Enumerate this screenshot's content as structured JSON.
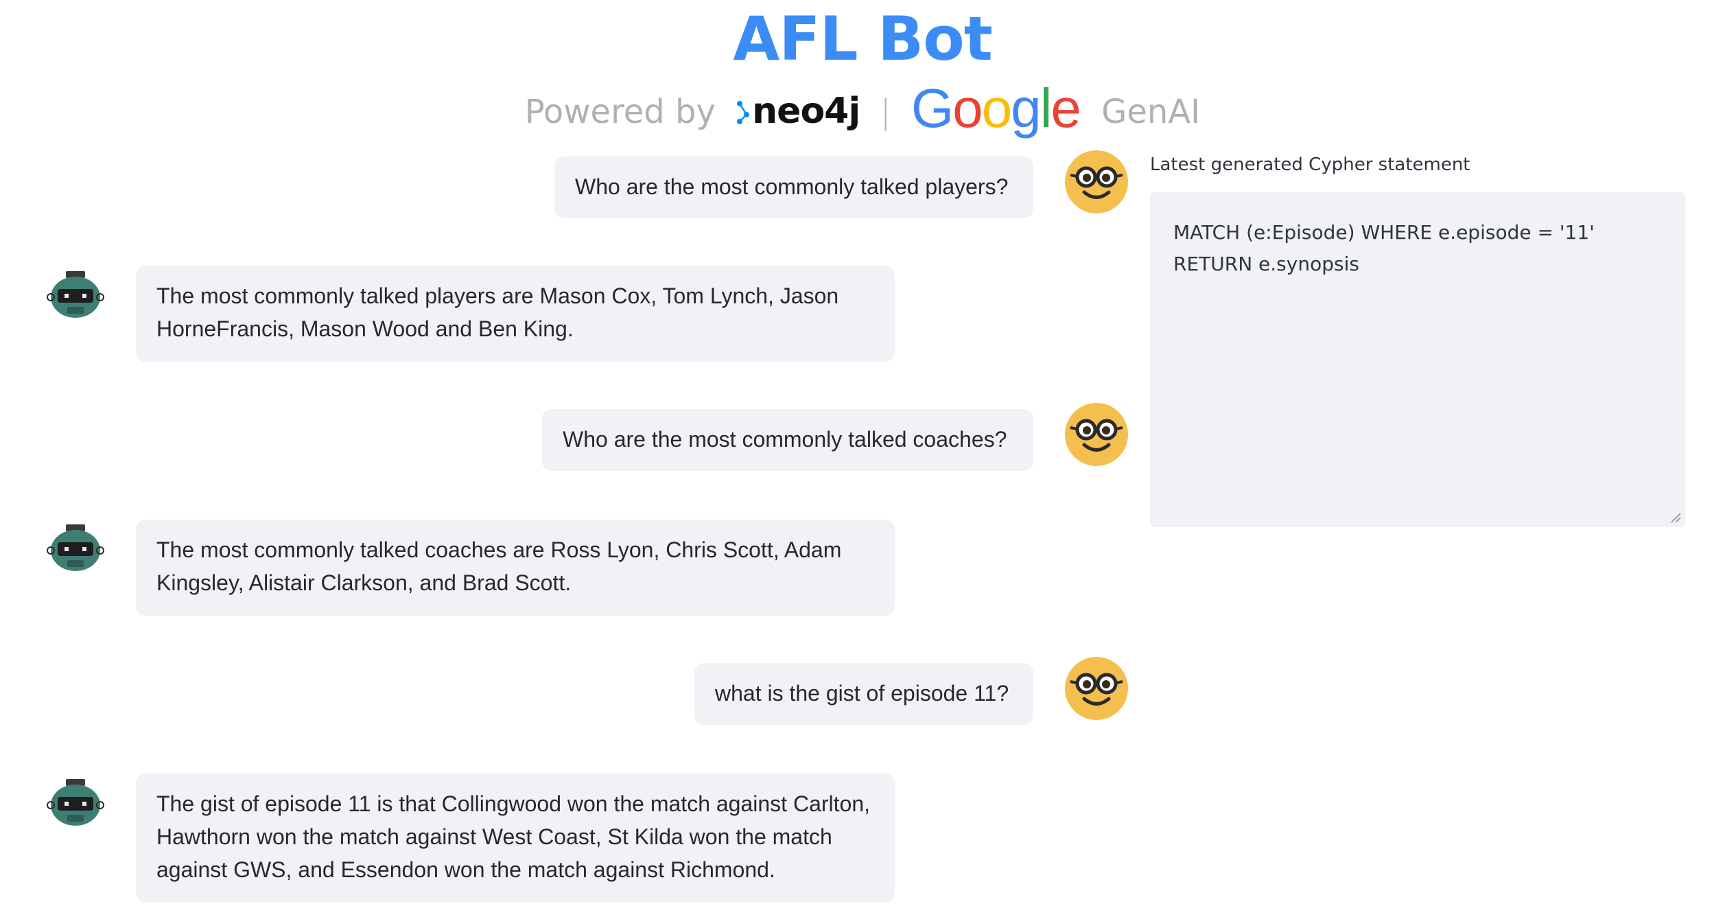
{
  "header": {
    "title": "AFL Bot",
    "powered_prefix": "Powered by",
    "neo4j": "neo4j",
    "separator": "|",
    "google": [
      "G",
      "o",
      "o",
      "g",
      "l",
      "e"
    ],
    "genai": "GenAI"
  },
  "colors": {
    "title": "#3b8cf5",
    "bubble_bg": "#f0f2f6",
    "text": "#262730",
    "user_avatar": "#f5bf4f",
    "bot_avatar": "#3f7f73",
    "google_blue": "#4285f4",
    "google_red": "#ea4335",
    "google_yellow": "#fbbc05",
    "google_green": "#34a853",
    "neo4j_accent": "#018bff"
  },
  "chat": {
    "messages": [
      {
        "role": "user",
        "avatar_icon": "nerd-face-icon",
        "text": "Who are the most commonly talked players?"
      },
      {
        "role": "assistant",
        "avatar_icon": "robot-icon",
        "text": "The most commonly talked players are Mason Cox, Tom Lynch, Jason HorneFrancis, Mason Wood and Ben King."
      },
      {
        "role": "user",
        "avatar_icon": "nerd-face-icon",
        "text": "Who are the most commonly talked coaches?"
      },
      {
        "role": "assistant",
        "avatar_icon": "robot-icon",
        "text": "The most commonly talked coaches are Ross Lyon, Chris Scott, Adam Kingsley, Alistair Clarkson, and Brad Scott."
      },
      {
        "role": "user",
        "avatar_icon": "nerd-face-icon",
        "text": "what is the gist of episode 11?"
      },
      {
        "role": "assistant",
        "avatar_icon": "robot-icon",
        "text": "The gist of episode 11 is that Collingwood won the match against Carlton, Hawthorn won the match against West Coast, St Kilda won the match against GWS, and Essendon won the match against Richmond."
      }
    ]
  },
  "sidebar": {
    "label": "Latest generated Cypher statement",
    "cypher": "MATCH (e:Episode) WHERE e.episode = '11' RETURN e.synopsis"
  }
}
